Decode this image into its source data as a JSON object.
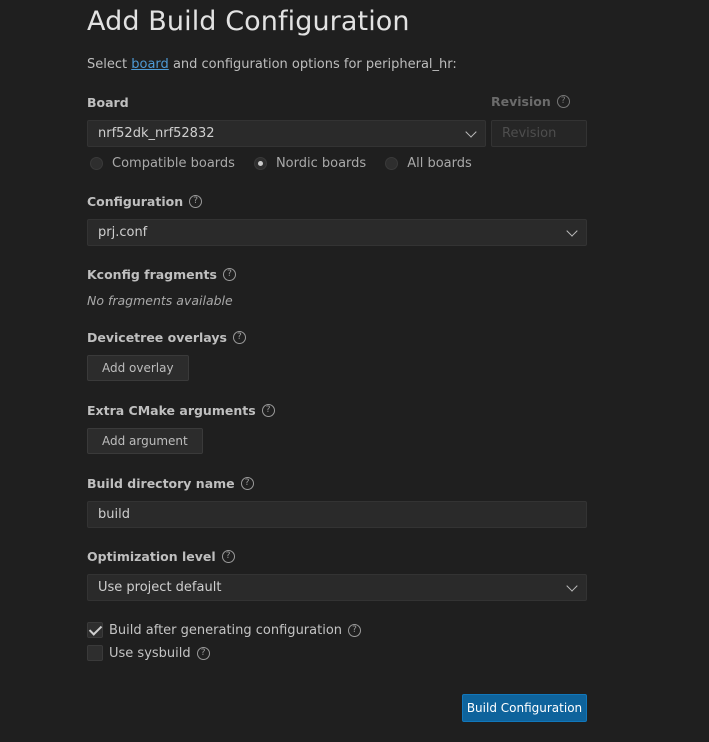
{
  "header": {
    "title": "Add Build Configuration",
    "subtitle_prefix": "Select",
    "subtitle_link": "board",
    "subtitle_suffix": "and configuration options for peripheral_hr:"
  },
  "board": {
    "label": "Board",
    "value": "nrf52dk_nrf52832",
    "options": [
      "Compatible boards",
      "Nordic boards",
      "All boards"
    ],
    "selected_option": "Nordic boards"
  },
  "revision": {
    "label": "Revision",
    "placeholder": "Revision"
  },
  "configuration": {
    "label": "Configuration",
    "value": "prj.conf"
  },
  "kconfig": {
    "label": "Kconfig fragments",
    "empty_text": "No fragments available"
  },
  "devicetree": {
    "label": "Devicetree overlays",
    "button": "Add overlay"
  },
  "cmake": {
    "label": "Extra CMake arguments",
    "button": "Add argument"
  },
  "build_dir": {
    "label": "Build directory name",
    "value": "build"
  },
  "optimization": {
    "label": "Optimization level",
    "value": "Use project default"
  },
  "options": {
    "build_after": {
      "label": "Build after generating configuration",
      "checked": true
    },
    "sysbuild": {
      "label": "Use sysbuild",
      "checked": false
    }
  },
  "submit": {
    "label": "Build Configuration"
  },
  "colors": {
    "background": "#1f1f1f",
    "primary_button": "#0e639c",
    "link": "#4e9ad6"
  }
}
